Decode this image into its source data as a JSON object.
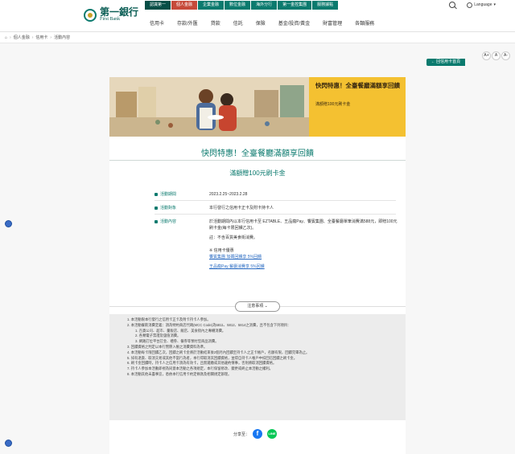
{
  "brand": {
    "name_cn": "第一銀行",
    "name_en": "First Bank"
  },
  "topnav": [
    {
      "label": "認識第一",
      "active": false,
      "home": true
    },
    {
      "label": "個人金融",
      "active": true,
      "home": false
    },
    {
      "label": "企業金融",
      "active": false,
      "home": false
    },
    {
      "label": "數位金融",
      "active": false,
      "home": false
    },
    {
      "label": "海外分行",
      "active": false,
      "home": false
    },
    {
      "label": "第一金控集團",
      "active": false,
      "home": false
    },
    {
      "label": "服務據點",
      "active": false,
      "home": false
    }
  ],
  "language": "Language",
  "mainnav": [
    "信用卡",
    "存款/外匯",
    "貸款",
    "信託",
    "保險",
    "基金/投資/黃金",
    "財富管理",
    "各類服務"
  ],
  "breadcrumb": [
    "個人金融",
    "信用卡",
    "活動內容"
  ],
  "back_label": "← 回信用卡首頁",
  "font_sizes": [
    "A+",
    "A",
    "A-"
  ],
  "banner": {
    "title": "快閃特惠！全臺餐廳滿額享回饋",
    "sub": "滿額贈100元刷卡金"
  },
  "title": "快閃特惠！全臺餐廳滿額享回饋",
  "subtitle": "滿額贈100元刷卡金",
  "details": [
    {
      "label": "活動期間",
      "value": "2023.2.25~2023.2.28"
    },
    {
      "label": "活動對象",
      "value": "本行發行之信用卡正卡及附卡持卡人"
    },
    {
      "label": "活動內容",
      "value": "於活動期間內以本行信用卡至 EZTABLE、王品瘋Pay、饗賓集團、全臺餐廳單筆消費滿588元，即贈100元刷卡金(每卡限回饋乙次)。"
    }
  ],
  "extra": {
    "note": "註：不含百貨美食街消費。",
    "more_label": "※ 信用卡優惠",
    "links": [
      "饗賓集團 加碼回饋享 5%回饋",
      "王品瘋Pay 餐廳消費享 5%回饋"
    ]
  },
  "notice_label": "注意事項",
  "notices": [
    {
      "text": "1. 本活動限本行發行之信用卡正卡及附卡持卡人參加。",
      "sub": false
    },
    {
      "text": "2. 本活動餐飲消費定義：須為特約商店代碼(MCC Code)為5811、5812、5814之消費，且不包含下列項目：",
      "sub": false
    },
    {
      "text": "1. 百貨公司、超市、量販店、飯店、美食街內之專櫃消費。",
      "sub": true
    },
    {
      "text": "2. 各類電子票證及儲值消費。",
      "sub": true
    },
    {
      "text": "3. 網路訂位平台訂金、禮券、餐券等預付型商品消費。",
      "sub": true
    },
    {
      "text": "3. 回饋資格之判定以本行實際入帳之消費資料為準。",
      "sub": false
    },
    {
      "text": "4. 本活動每卡限回饋乙次，回饋之刷卡金將於活動結束後2個月內回饋至持卡人之正卡帳戶，名額有限，回饋完畢為止。",
      "sub": false
    },
    {
      "text": "5. 如有退貨、取消交易或其他不當行為者，本行得取消其回饋資格，並得自持卡人帳戶中扣回已回饋之刷卡金。",
      "sub": false
    },
    {
      "text": "6. 刷卡金回饋時，持卡人之信用卡須為有效卡，且無遲繳或其他違約情事，否則將取消回饋資格。",
      "sub": false
    },
    {
      "text": "7. 持卡人參加本活動即視為同意本活動之各項規定，本行保留修改、變更或終止本活動之權利。",
      "sub": false
    },
    {
      "text": "8. 本活動其他未盡事宜，悉依本行信用卡約定條款及相關規定辦理。",
      "sub": false
    }
  ],
  "share_label": "分享至：",
  "share_icons": [
    "facebook-icon",
    "line-icon"
  ]
}
